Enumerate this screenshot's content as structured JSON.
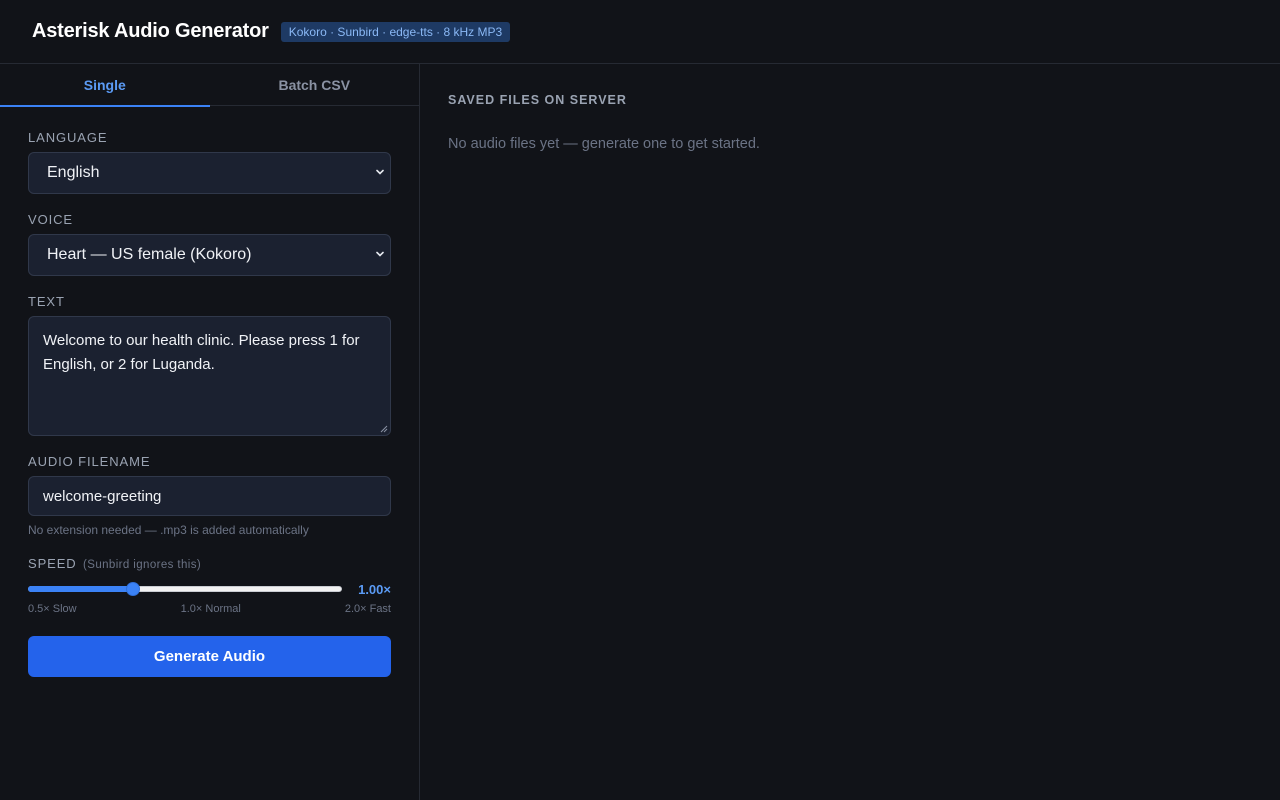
{
  "header": {
    "title": "Asterisk Audio Generator",
    "badge": "Kokoro · Sunbird · edge-tts · 8 kHz MP3"
  },
  "tabs": [
    {
      "label": "Single",
      "active": true
    },
    {
      "label": "Batch CSV",
      "active": false
    }
  ],
  "form": {
    "language": {
      "label": "LANGUAGE",
      "value": "English"
    },
    "voice": {
      "label": "VOICE",
      "value": "Heart — US female (Kokoro)"
    },
    "text": {
      "label": "TEXT",
      "value": "Welcome to our health clinic. Please press 1 for English, or 2 for Luganda."
    },
    "filename": {
      "label": "AUDIO FILENAME",
      "value": "welcome-greeting",
      "hint": "No extension needed — .mp3 is added automatically"
    },
    "speed": {
      "label": "SPEED",
      "label_hint": "(Sunbird ignores this)",
      "value": 1.0,
      "value_text": "1.00×",
      "min": 0.5,
      "max": 2.0,
      "scale": [
        "0.5× Slow",
        "1.0× Normal",
        "2.0× Fast"
      ]
    },
    "generate_label": "Generate Audio"
  },
  "files": {
    "title": "SAVED FILES ON SERVER",
    "empty_message": "No audio files yet — generate one to get started."
  },
  "colors": {
    "accent": "#3b82f6",
    "badge_bg": "#1e3a64",
    "background": "#111318"
  }
}
